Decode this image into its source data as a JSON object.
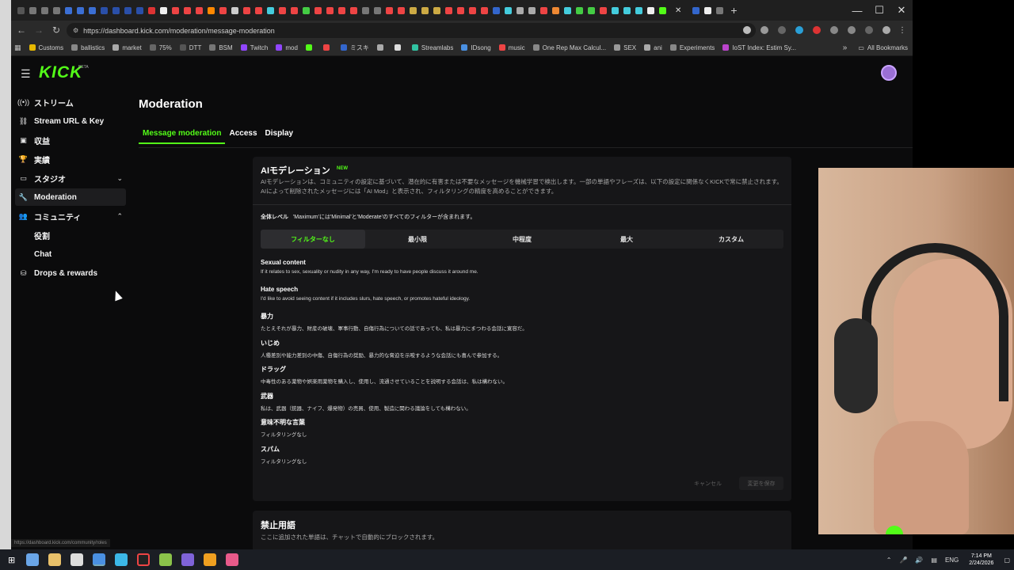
{
  "browser": {
    "url": "https://dashboard.kick.com/moderation/message-moderation",
    "bookmarks": [
      "Customs",
      "ballistics",
      "market",
      "75%",
      "DTT",
      "BSM",
      "Twitch",
      "mod",
      "ミスキ",
      "Streamlabs",
      "IDsong",
      "music",
      "One Rep Max Calcul...",
      "SEX",
      "ani",
      "Experiments",
      "IoST Index: Estim Sy..."
    ],
    "all_bookmarks": "All Bookmarks",
    "status_url": "https://dashboard.kick.com/community/roles"
  },
  "brand": {
    "logo": "KICK",
    "badge": "BETA"
  },
  "sidebar": {
    "items": [
      {
        "label": "ストリーム",
        "icon": "broadcast-icon"
      },
      {
        "label": "Stream URL & Key",
        "icon": "link-icon"
      },
      {
        "label": "収益",
        "icon": "revenue-icon"
      },
      {
        "label": "実績",
        "icon": "trophy-icon"
      },
      {
        "label": "スタジオ",
        "icon": "studio-icon"
      },
      {
        "label": "Moderation",
        "icon": "wrench-icon"
      },
      {
        "label": "コミュニティ",
        "icon": "community-icon"
      },
      {
        "label": "役割",
        "icon": ""
      },
      {
        "label": "Chat",
        "icon": ""
      },
      {
        "label": "Drops & rewards",
        "icon": "drops-icon"
      }
    ]
  },
  "page": {
    "title": "Moderation",
    "tabs": [
      "Message moderation",
      "Access",
      "Display"
    ]
  },
  "ai_card": {
    "title": "AIモデレーション",
    "badge": "NEW",
    "description": "AIモデレーションは、コミュニティの設定に基づいて、潜在的に有害または不要なメッセージを機械学習で検出します。一部の単語やフレーズは、以下の設定に関係なくKICKで常に禁止されます。AIによって削除されたメッセージには「AI Mod」と表示され、フィルタリングの精度を高めることができます。",
    "level_label": "全体レベル",
    "level_note": "'Maximum'には'Minimal'と'Moderate'のすべてのフィルターが含まれます。",
    "levels": [
      "フィルターなし",
      "最小限",
      "中程度",
      "最大",
      "カスタム"
    ],
    "categories": [
      {
        "name": "Sexual content",
        "desc": "If it relates to sex, sexuality or nudity in any way, I'm ready to have people discuss it around me."
      },
      {
        "name": "Hate speech",
        "desc": "I'd like to avoid seeing content if it includes slurs, hate speech, or promotes hateful ideology."
      },
      {
        "name": "暴力",
        "desc": "たとえそれが暴力、財産の破壊、軍事行動、自傷行為についての話であっても、私は暴力にまつわる会話に寛容だ。"
      },
      {
        "name": "いじめ",
        "desc": "人種差別や能力差別の中傷、自傷行為の奨励、暴力的な脅迫を示唆するような会話にも喜んで参加する。"
      },
      {
        "name": "ドラッグ",
        "desc": "中毒性のある薬物や娯楽用薬物を購入し、使用し、流通させていることを説明する会話は、私は構わない。"
      },
      {
        "name": "武器",
        "desc": "私は、武器（銃器、ナイフ、爆発物）の売買、使用、製造に関わる議論をしても構わない。"
      },
      {
        "name": "意味不明な言葉",
        "desc": "フィルタリングなし"
      },
      {
        "name": "スパム",
        "desc": "フィルタリングなし"
      }
    ],
    "cancel": "キャンセル",
    "save": "変更を保存"
  },
  "blocked_card": {
    "title": "禁止用語",
    "description": "ここに追加された単語は、チャットで自動的にブロックされます。"
  },
  "taskbar": {
    "lang": "ENG",
    "time": "7:14 PM",
    "date": "2/24/2026"
  }
}
